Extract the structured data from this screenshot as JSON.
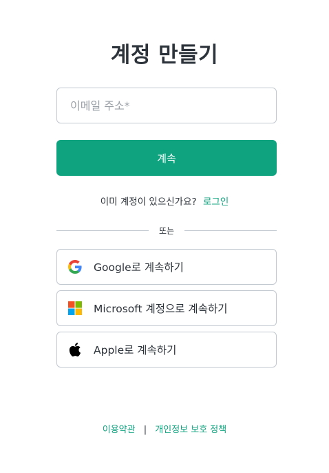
{
  "page": {
    "title": "계정 만들기"
  },
  "form": {
    "email_placeholder": "이메일 주소*",
    "email_value": "",
    "continue_label": "계속"
  },
  "login_prompt": {
    "text": "이미 계정이 있으신가요?",
    "link_label": "로그인"
  },
  "divider": {
    "text": "또는"
  },
  "social": {
    "google_label": "Google로 계속하기",
    "microsoft_label": "Microsoft 계정으로 계속하기",
    "apple_label": "Apple로 계속하기",
    "google_icon": "google-icon",
    "microsoft_icon": "microsoft-icon",
    "apple_icon": "apple-icon"
  },
  "footer": {
    "terms_label": "이용약관",
    "separator": "|",
    "privacy_label": "개인정보 보호 정책"
  },
  "colors": {
    "accent": "#10a37f",
    "text": "#2d333a",
    "border": "#c2c8d0"
  }
}
